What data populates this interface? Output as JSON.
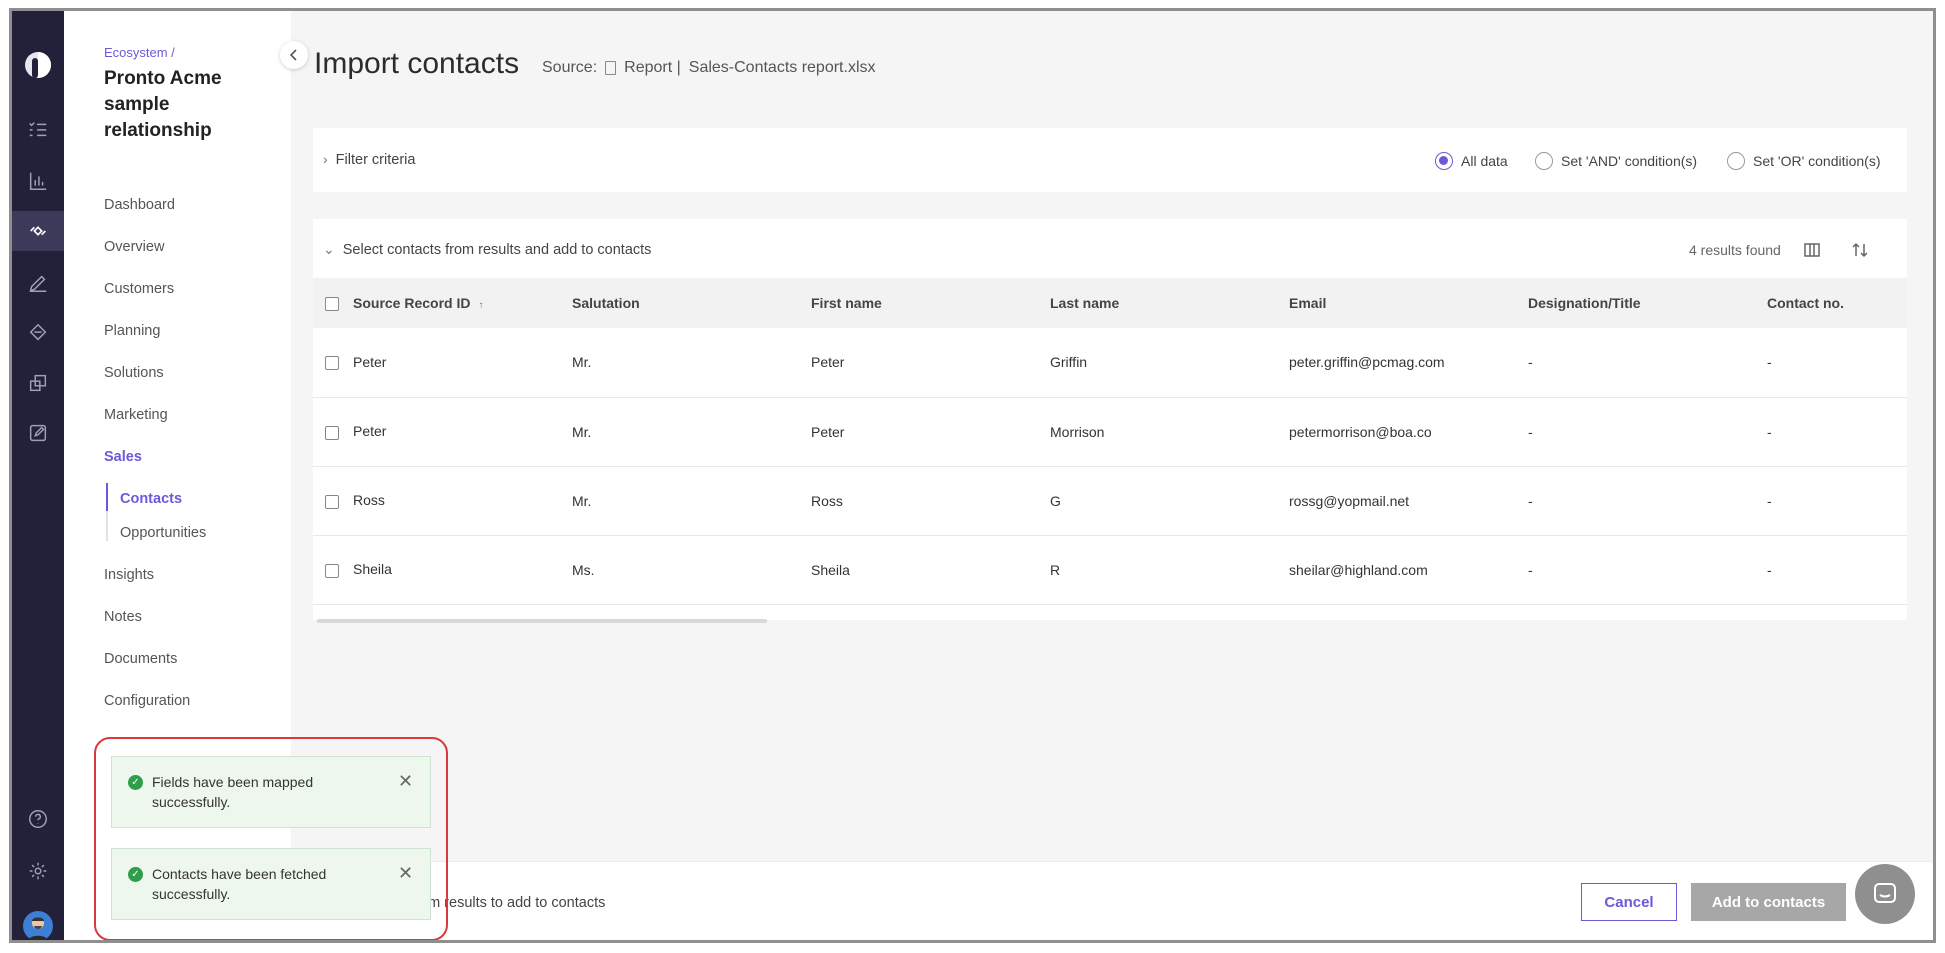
{
  "breadcrumb": "Ecosystem /",
  "project_title": "Pronto Acme sample relationship",
  "nav": {
    "items": [
      "Dashboard",
      "Overview",
      "Customers",
      "Planning",
      "Solutions",
      "Marketing",
      "Sales",
      "Insights",
      "Notes",
      "Documents",
      "Configuration"
    ],
    "active": "Sales",
    "sub_items": [
      "Contacts",
      "Opportunities"
    ],
    "active_sub": "Contacts"
  },
  "rail_icons": [
    "logo",
    "tasks-icon",
    "chart-icon",
    "ecosystem-icon",
    "pen-icon",
    "stack-icon",
    "layers-icon",
    "edit-icon",
    "help-icon",
    "settings-icon",
    "user-avatar"
  ],
  "page": {
    "title": "Import contacts",
    "source_label": "Source:",
    "source_type": "Report |",
    "source_file": "Sales-Contacts report.xlsx"
  },
  "filter": {
    "label": "Filter criteria",
    "options": [
      "All data",
      "Set 'AND' condition(s)",
      "Set 'OR' condition(s)"
    ],
    "selected": "All data"
  },
  "results": {
    "header": "Select contacts from results and add to contacts",
    "count": "4 results found",
    "columns": [
      "Source Record ID",
      "Salutation",
      "First name",
      "Last name",
      "Email",
      "Designation/Title",
      "Contact no."
    ],
    "sort_indicator": "↑",
    "rows": [
      [
        "Peter",
        "Mr.",
        "Peter",
        "Griffin",
        "peter.griffin@pcmag.com",
        "-",
        "-"
      ],
      [
        "Peter",
        "Mr.",
        "Peter",
        "Morrison",
        "petermorrison@boa.co",
        "-",
        "-"
      ],
      [
        "Ross",
        "Mr.",
        "Ross",
        "G",
        "rossg@yopmail.net",
        "-",
        "-"
      ],
      [
        "Sheila",
        "Ms.",
        "Sheila",
        "R",
        "sheilar@highland.com",
        "-",
        "-"
      ]
    ]
  },
  "footer": {
    "hint": "om results to add to contacts",
    "cancel": "Cancel",
    "add": "Add to contacts"
  },
  "toasts": [
    {
      "message": "Fields have been mapped successfully."
    },
    {
      "message": "Contacts have been fetched successfully."
    }
  ],
  "colors": {
    "accent": "#6a5ad8",
    "rail": "#23213a",
    "success": "#2e9e4a",
    "highlight": "#d63a3a"
  }
}
